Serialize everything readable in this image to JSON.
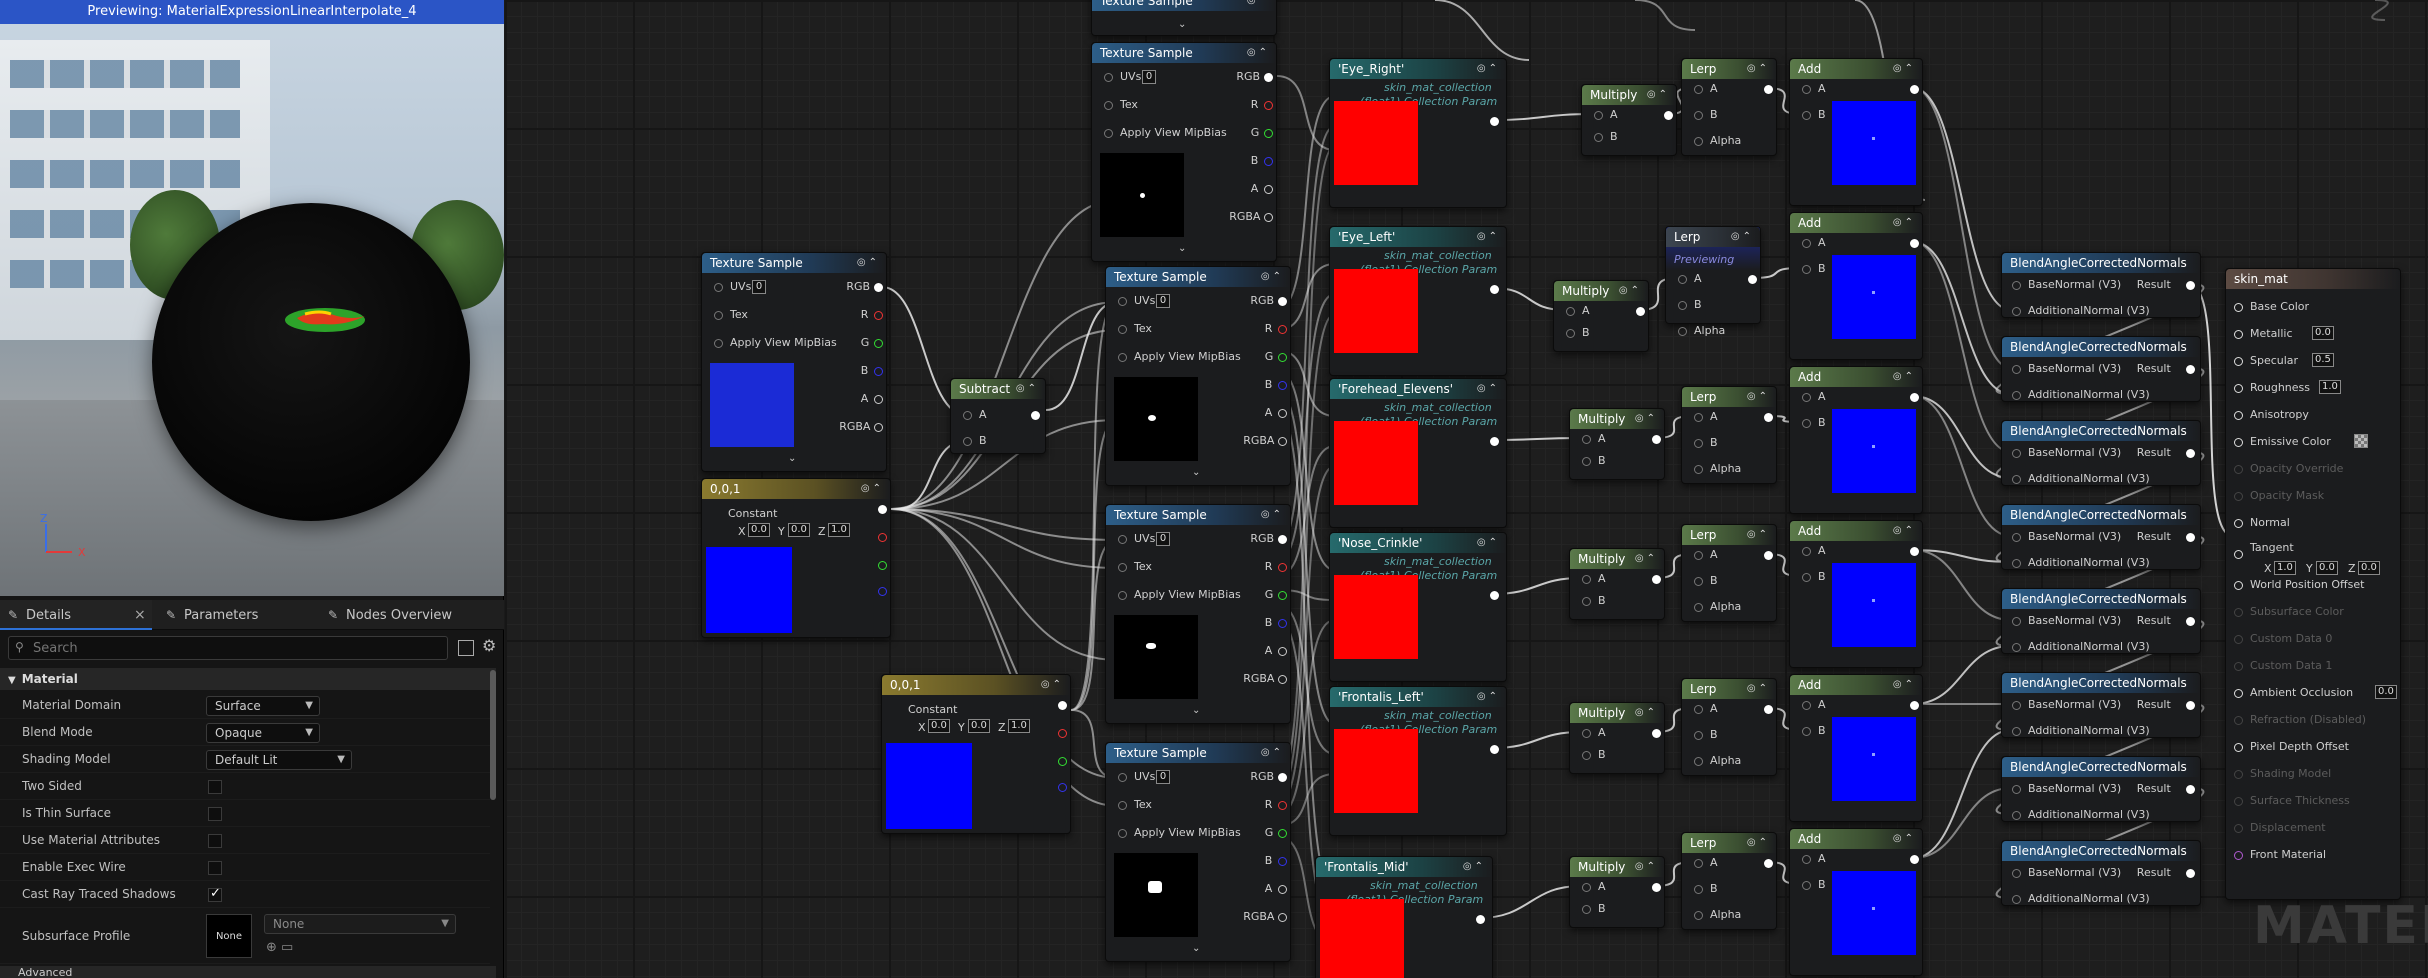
{
  "preview": {
    "title": "Previewing: MaterialExpressionLinearInterpolate_4",
    "axis_z": "Z",
    "axis_x": "X"
  },
  "tabs": {
    "details": "Details",
    "parameters": "Parameters",
    "nodes_overview": "Nodes Overview"
  },
  "search": {
    "placeholder": "Search"
  },
  "section_material": "Material",
  "properties": [
    {
      "label": "Material Domain",
      "type": "select",
      "value": "Surface"
    },
    {
      "label": "Blend Mode",
      "type": "select",
      "value": "Opaque"
    },
    {
      "label": "Shading Model",
      "type": "select",
      "value": "Default Lit"
    },
    {
      "label": "Two Sided",
      "type": "check",
      "checked": false
    },
    {
      "label": "Is Thin Surface",
      "type": "check",
      "checked": false
    },
    {
      "label": "Use Material Attributes",
      "type": "check",
      "checked": false
    },
    {
      "label": "Enable Exec Wire",
      "type": "check",
      "checked": false
    },
    {
      "label": "Cast Ray Traced Shadows",
      "type": "check",
      "checked": true
    }
  ],
  "subsurface": {
    "label": "Subsurface Profile",
    "thumb": "None",
    "select": "None"
  },
  "advanced": "Advanced",
  "nodes": {
    "tex_sample_title": "Texture Sample",
    "uvs": "UVs",
    "uvs_val": "0",
    "tex": "Tex",
    "mip": "Apply View MipBias",
    "rgb": "RGB",
    "r": "R",
    "g": "G",
    "b": "B",
    "a": "A",
    "rgba": "RGBA",
    "subtract": "Subtract",
    "pin_a": "A",
    "pin_b": "B",
    "alpha": "Alpha",
    "const_title": "0,0,1",
    "constant": "Constant",
    "x": "X",
    "y": "Y",
    "z": "Z",
    "x_val": "0.0",
    "y_val": "0.0",
    "z_val": "1.0",
    "multiply": "Multiply",
    "lerp": "Lerp",
    "add": "Add",
    "previewing": "Previewing",
    "collection_line1": "skin_mat_collection",
    "collection_line2": "(float1) Collection Param",
    "params": [
      "'Eye_Right'",
      "'Eye_Left'",
      "'Forehead_Elevens'",
      "'Nose_Crinkle'",
      "'Frontalis_Left'",
      "'Frontalis_Mid'"
    ],
    "blend_title": "BlendAngleCorrectedNormals",
    "base_normal": "BaseNormal (V3)",
    "additional_normal": "AdditionalNormal (V3)",
    "result": "Result"
  },
  "skin_mat": {
    "title": "skin_mat",
    "pins": [
      {
        "label": "Base Color",
        "enabled": true
      },
      {
        "label": "Metallic",
        "enabled": true,
        "value": "0.0"
      },
      {
        "label": "Specular",
        "enabled": true,
        "value": "0.5"
      },
      {
        "label": "Roughness",
        "enabled": true,
        "value": "1.0"
      },
      {
        "label": "Anisotropy",
        "enabled": true
      },
      {
        "label": "Emissive Color",
        "enabled": true
      },
      {
        "label": "Opacity Override",
        "enabled": false
      },
      {
        "label": "Opacity Mask",
        "enabled": false
      },
      {
        "label": "Normal",
        "enabled": true
      },
      {
        "label": "Tangent",
        "enabled": true
      },
      {
        "label": "World Position Offset",
        "enabled": true
      },
      {
        "label": "Subsurface Color",
        "enabled": false
      },
      {
        "label": "Custom Data 0",
        "enabled": false
      },
      {
        "label": "Custom Data 1",
        "enabled": false
      },
      {
        "label": "Ambient Occlusion",
        "enabled": true,
        "value": "0.0"
      },
      {
        "label": "Refraction (Disabled)",
        "enabled": false
      },
      {
        "label": "Pixel Depth Offset",
        "enabled": true
      },
      {
        "label": "Shading Model",
        "enabled": false
      },
      {
        "label": "Surface Thickness",
        "enabled": false
      },
      {
        "label": "Displacement",
        "enabled": false
      },
      {
        "label": "Front Material",
        "enabled": true
      }
    ],
    "tangent_x": "1.0",
    "tangent_y": "0.0",
    "tangent_z": "0.0"
  },
  "watermark": "MATER",
  "colors": {
    "accent": "#2d71d6",
    "param_swatch": "#ff0000",
    "add_swatch": "#0000ff"
  }
}
